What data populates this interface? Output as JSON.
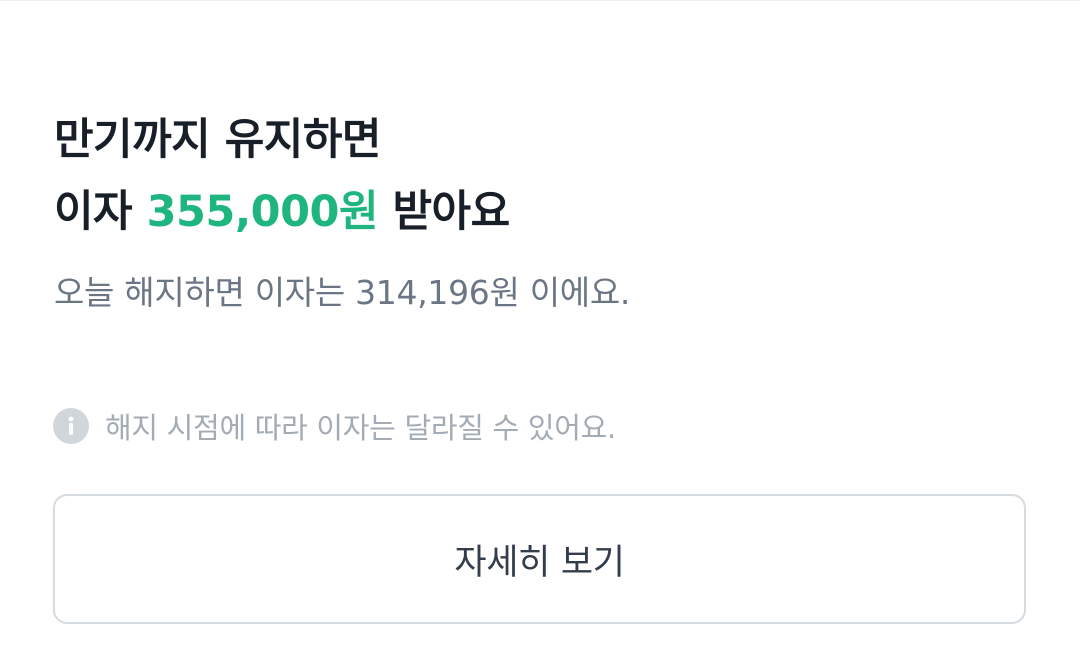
{
  "headline": {
    "line1": "만기까지 유지하면",
    "line2_prefix": "이자 ",
    "amount": "355,000원",
    "line2_suffix": " 받아요"
  },
  "subtext": "오늘 해지하면 이자는 314,196원 이에요.",
  "notice": {
    "icon": "info-icon",
    "text": "해지 시점에 따라 이자는 달라질 수 있어요."
  },
  "detail_button": {
    "label": "자세히 보기"
  },
  "colors": {
    "accent": "#1fb57f",
    "title": "#191f28",
    "subtext": "#6b7684",
    "notice": "#a3abb5",
    "icon_bg": "#d1d6db",
    "button_border": "#d6dbe0"
  }
}
